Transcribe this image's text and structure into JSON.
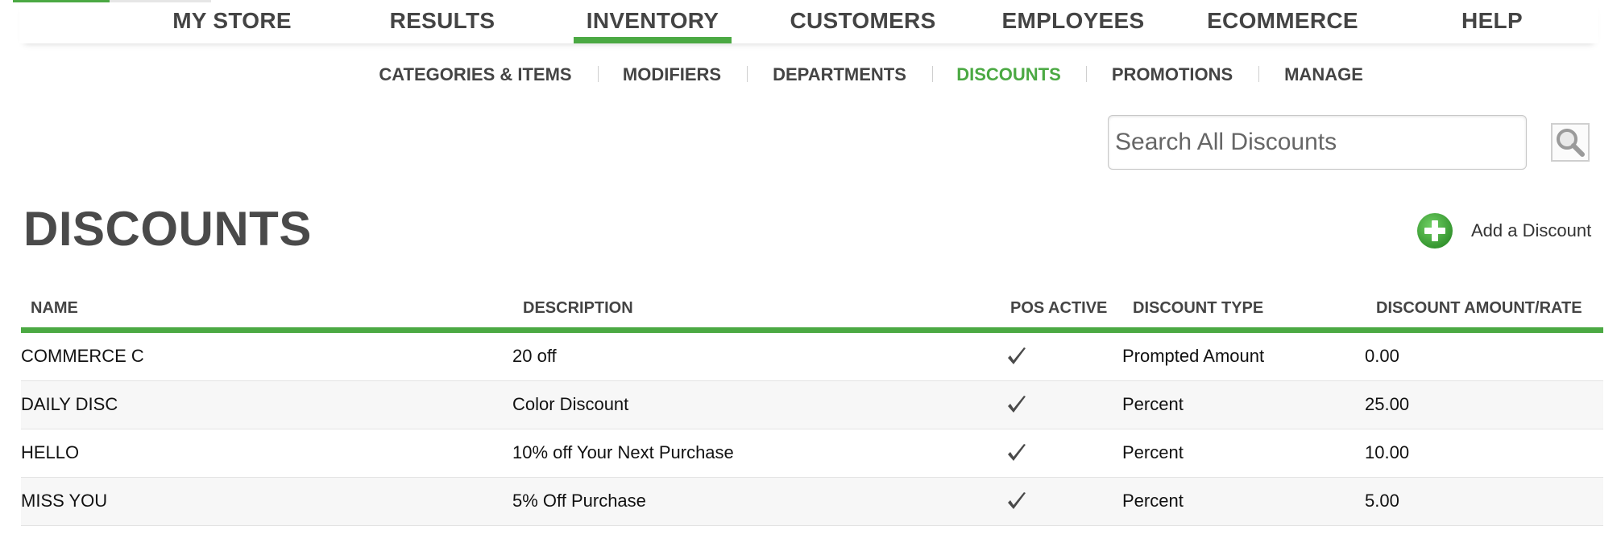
{
  "top_nav": {
    "items": [
      {
        "label": "MY STORE",
        "active": false
      },
      {
        "label": "RESULTS",
        "active": false
      },
      {
        "label": "INVENTORY",
        "active": true
      },
      {
        "label": "CUSTOMERS",
        "active": false
      },
      {
        "label": "EMPLOYEES",
        "active": false
      },
      {
        "label": "ECOMMERCE",
        "active": false
      },
      {
        "label": "HELP",
        "active": false
      }
    ]
  },
  "sub_nav": {
    "items": [
      {
        "label": "CATEGORIES & ITEMS",
        "active": false
      },
      {
        "label": "MODIFIERS",
        "active": false
      },
      {
        "label": "DEPARTMENTS",
        "active": false
      },
      {
        "label": "DISCOUNTS",
        "active": true
      },
      {
        "label": "PROMOTIONS",
        "active": false
      },
      {
        "label": "MANAGE",
        "active": false
      }
    ]
  },
  "search": {
    "placeholder": "Search All Discounts",
    "value": "",
    "icon": "magnifier-icon"
  },
  "page": {
    "title": "DISCOUNTS",
    "add_label": "Add a Discount",
    "add_icon": "plus-circle-icon"
  },
  "table": {
    "headers": {
      "name": "NAME",
      "description": "DESCRIPTION",
      "pos_active": "POS ACTIVE",
      "discount_type": "DISCOUNT TYPE",
      "amount_rate": "DISCOUNT AMOUNT/RATE"
    },
    "rows": [
      {
        "name": "COMMERCE C",
        "description": "20 off",
        "pos_active": true,
        "discount_type": "Prompted Amount",
        "amount_rate": "0.00"
      },
      {
        "name": "DAILY DISC",
        "description": "Color Discount",
        "pos_active": true,
        "discount_type": "Percent",
        "amount_rate": "25.00"
      },
      {
        "name": "HELLO",
        "description": "10% off Your Next Purchase",
        "pos_active": true,
        "discount_type": "Percent",
        "amount_rate": "10.00"
      },
      {
        "name": "MISS YOU",
        "description": "5% Off Purchase",
        "pos_active": true,
        "discount_type": "Percent",
        "amount_rate": "5.00"
      }
    ]
  },
  "colors": {
    "accent": "#4ba943",
    "text_dark": "#444444",
    "row_alt": "#f7f7f7"
  }
}
